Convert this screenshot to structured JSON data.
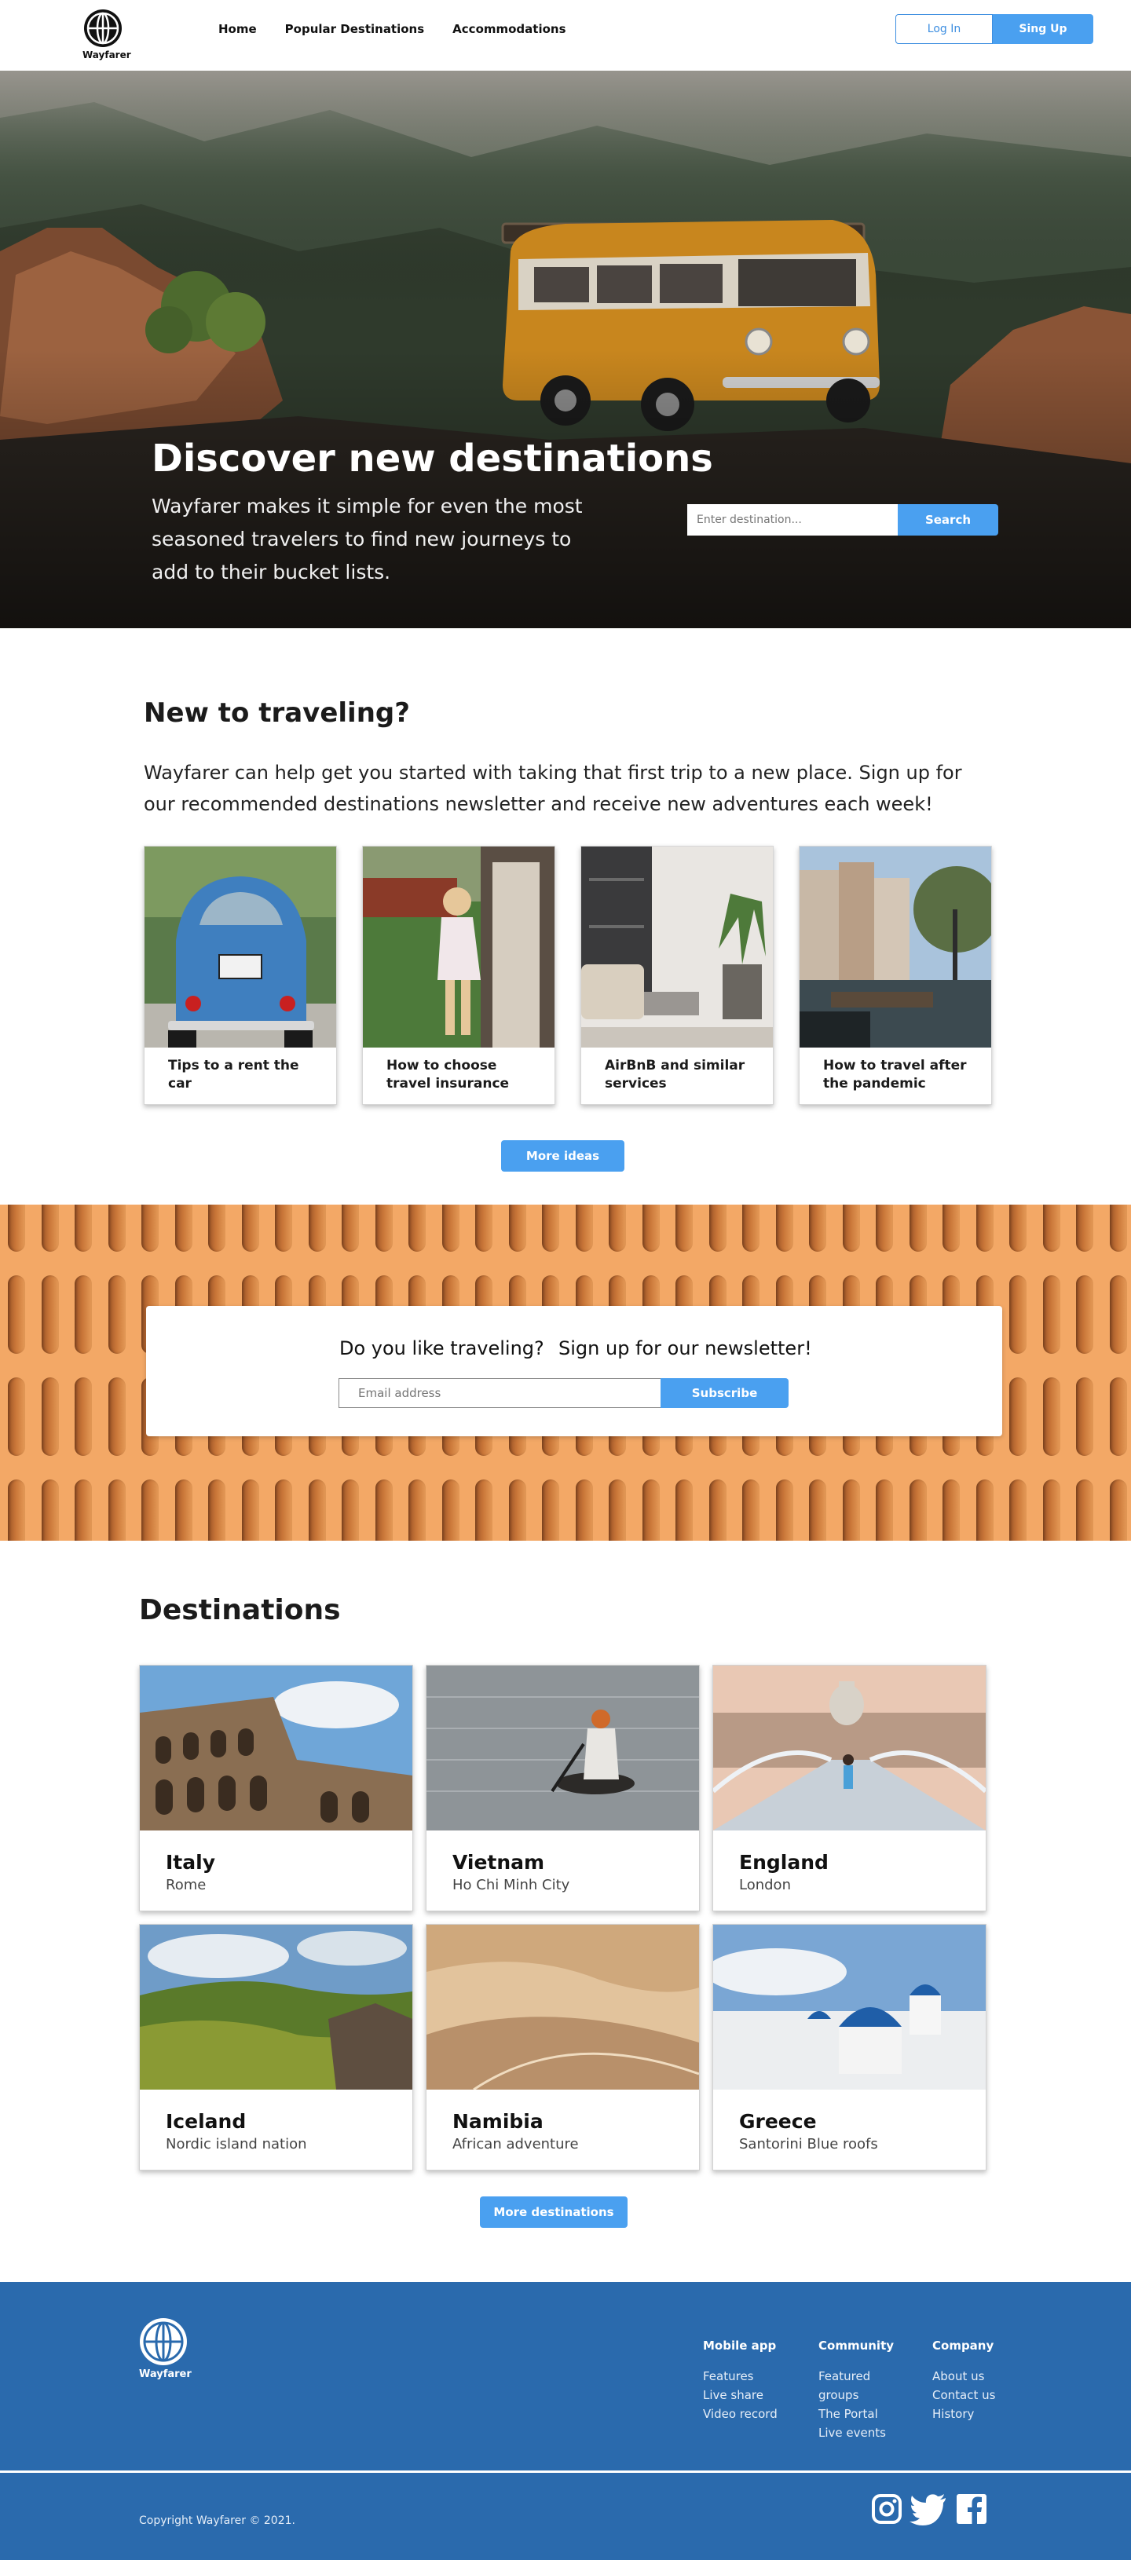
{
  "brand": {
    "name": "Wayfarer"
  },
  "nav": {
    "items": [
      "Home",
      "Popular Destinations",
      "Accommodations"
    ]
  },
  "auth": {
    "login": "Log In",
    "signup": "Sing Up"
  },
  "hero": {
    "title": "Discover new destinations",
    "subtitle": "Wayfarer makes it simple for even the most seasoned travelers to find new journeys to add to their bucket lists.",
    "search_placeholder": "Enter destination...",
    "search_button": "Search"
  },
  "intro": {
    "title": "New to traveling?",
    "text": "Wayfarer can help get you started with taking that first trip to a new place. Sign up for our recommended destinations newsletter and receive new adventures each week!",
    "cards": [
      {
        "caption": "Tips to a rent the car"
      },
      {
        "caption": "How to choose travel insurance"
      },
      {
        "caption": "AirBnB and similar services"
      },
      {
        "caption": "How to travel after the pandemic"
      }
    ],
    "more_button": "More ideas"
  },
  "newsletter": {
    "question": "Do you like traveling?",
    "signup_text": "Sign up for our newsletter!",
    "email_placeholder": "Email address",
    "button": "Subscribe"
  },
  "destinations": {
    "title": "Destinations",
    "items": [
      {
        "name": "Italy",
        "sub": "Rome"
      },
      {
        "name": "Vietnam",
        "sub": "Ho Chi Minh City"
      },
      {
        "name": "England",
        "sub": "London"
      },
      {
        "name": "Iceland",
        "sub": "Nordic island nation"
      },
      {
        "name": "Namibia",
        "sub": "African adventure"
      },
      {
        "name": "Greece",
        "sub": "Santorini Blue roofs"
      }
    ],
    "more_button": "More destinations"
  },
  "footer": {
    "columns": [
      {
        "title": "Mobile app",
        "links": [
          "Features",
          "Live share",
          "Video record"
        ]
      },
      {
        "title": "Community",
        "links": [
          "Featured",
          "groups",
          "The Portal",
          "Live events"
        ]
      },
      {
        "title": "Company",
        "links": [
          "About us",
          "Contact us",
          "History"
        ]
      }
    ],
    "copyright": "Copyright Wayfarer ©  2021.",
    "social_icons": [
      "instagram-icon",
      "twitter-icon",
      "facebook-icon"
    ]
  },
  "colors": {
    "accent": "#4aa0f0",
    "footer": "#2a6aad",
    "newsletter_bg": "#f3a866"
  }
}
